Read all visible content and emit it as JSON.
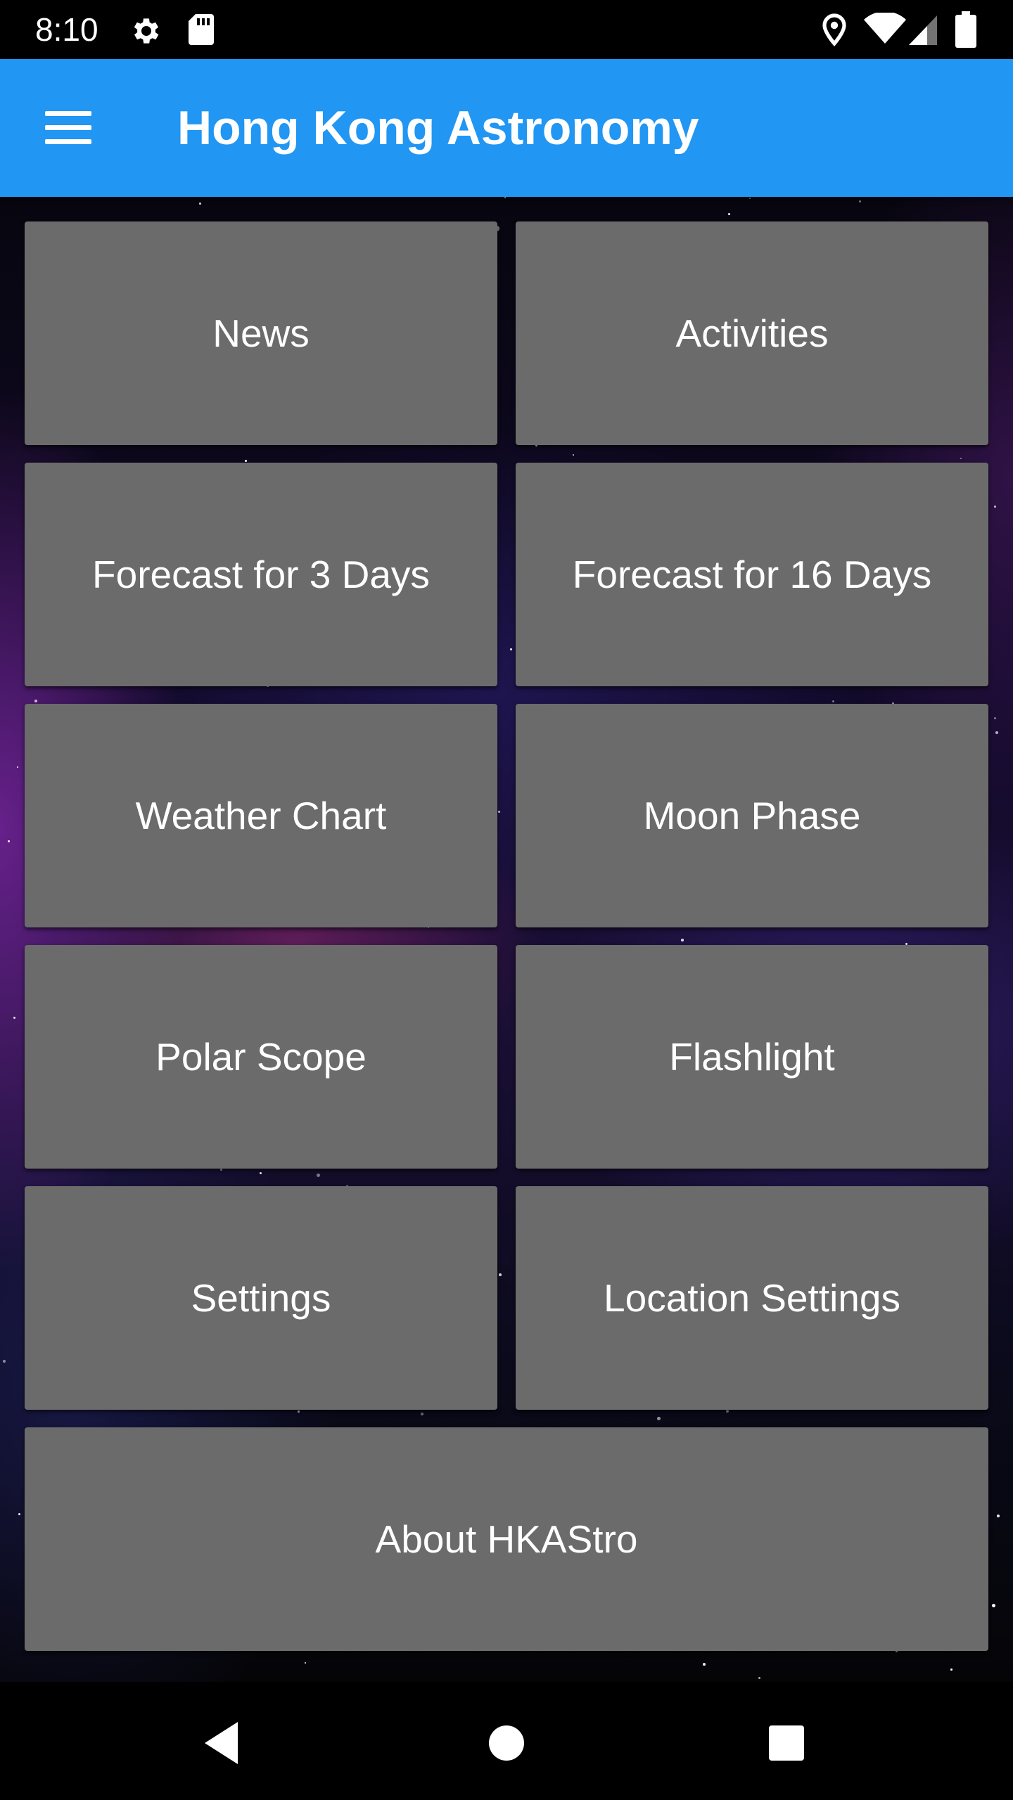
{
  "status_bar": {
    "time": "8:10",
    "left_icons": [
      "settings-icon",
      "sd-card-icon"
    ],
    "right_icons": [
      "location-icon",
      "wifi-icon",
      "signal-icon",
      "battery-icon"
    ]
  },
  "app_bar": {
    "title": "Hong Kong Astronomy",
    "menu_icon": "hamburger-menu-icon",
    "color": "#2196F3"
  },
  "tiles": [
    {
      "label": "News"
    },
    {
      "label": "Activities"
    },
    {
      "label": "Forecast for 3 Days"
    },
    {
      "label": "Forecast for 16 Days"
    },
    {
      "label": "Weather Chart"
    },
    {
      "label": "Moon Phase"
    },
    {
      "label": "Polar Scope"
    },
    {
      "label": "Flashlight"
    },
    {
      "label": "Settings"
    },
    {
      "label": "Location Settings"
    },
    {
      "label": "About HKAStro"
    }
  ],
  "tile_color": "#6b6b6b",
  "nav_bar": {
    "buttons": [
      "back-icon",
      "home-icon",
      "recents-icon"
    ]
  }
}
